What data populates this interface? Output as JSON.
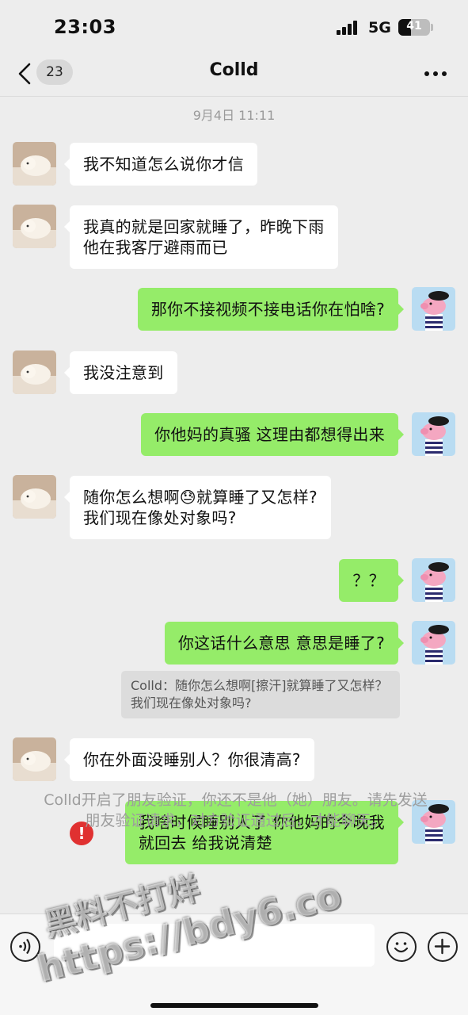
{
  "status_bar": {
    "time": "23:03",
    "network": "5G",
    "battery_level": "41",
    "battery_fraction": 0.41
  },
  "nav": {
    "unread_count": "23",
    "title": "Colld"
  },
  "chat": {
    "timestamp": "9月4日 11:11",
    "messages": [
      {
        "side": "in",
        "text": "我不知道怎么说你才信"
      },
      {
        "side": "in",
        "text": "我真的就是回家就睡了，昨晚下雨\n他在我客厅避雨而已"
      },
      {
        "side": "out",
        "text": "那你不接视频不接电话你在怕啥?"
      },
      {
        "side": "in",
        "text": "我没注意到"
      },
      {
        "side": "out",
        "text": "你他妈的真骚 这理由都想得出来"
      },
      {
        "side": "in",
        "text": "随你怎么想啊😓就算睡了又怎样?\n我们现在像处对象吗?"
      },
      {
        "side": "out",
        "text": "？？"
      },
      {
        "side": "out",
        "text": "你这话什么意思 意思是睡了?"
      },
      {
        "side": "quote",
        "text": "Colld：随你怎么想啊[擦汗]就算睡了又怎样？我们现在像处对象吗?"
      },
      {
        "side": "in",
        "text": "你在外面没睡别人？你很清高?"
      },
      {
        "side": "out",
        "text": "我啥时候睡别人了 你他妈的今晚我\n就回去 给我说清楚",
        "failed": true
      }
    ],
    "system_notice": "Colld开启了朋友验证，你还不是他（她）朋友。请先发送朋友验证请求，对方验证通过后，才能聊天。"
  },
  "watermark": {
    "line1": "黑料不打烊",
    "line2": "https://bdy6.co"
  },
  "icons": {
    "back": "chevron-left-icon",
    "more": "more-icon",
    "voice": "voice-icon",
    "emoji": "emoji-icon",
    "plus": "plus-icon",
    "error": "error-icon"
  },
  "colors": {
    "outgoing_bubble": "#95ec69",
    "incoming_bubble": "#ffffff",
    "background": "#ededed",
    "error": "#e03131"
  }
}
